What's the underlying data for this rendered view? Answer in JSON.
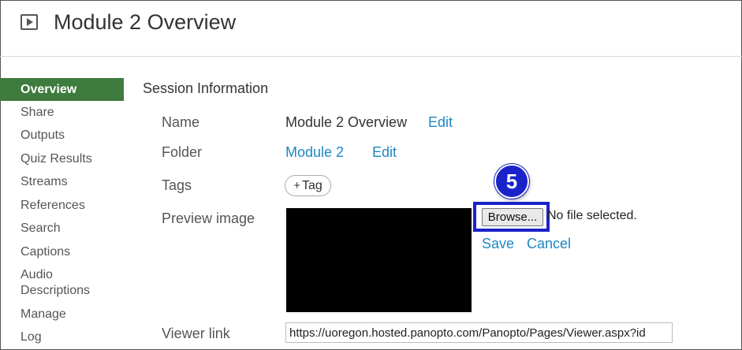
{
  "header": {
    "title": "Module 2 Overview"
  },
  "sidebar": {
    "items": [
      {
        "label": "Overview",
        "active": true
      },
      {
        "label": "Share"
      },
      {
        "label": "Outputs"
      },
      {
        "label": "Quiz Results"
      },
      {
        "label": "Streams"
      },
      {
        "label": "References"
      },
      {
        "label": "Search"
      },
      {
        "label": "Captions"
      },
      {
        "label": "Audio Descriptions"
      },
      {
        "label": "Manage"
      },
      {
        "label": "Log"
      }
    ]
  },
  "session": {
    "section_title": "Session Information",
    "name_label": "Name",
    "name_value": "Module 2 Overview",
    "folder_label": "Folder",
    "folder_value": "Module 2",
    "edit_label": "Edit",
    "tags_label": "Tags",
    "tag_button_label": "Tag",
    "preview_label": "Preview image",
    "browse_label": "Browse...",
    "no_file_text": "No file selected.",
    "save_label": "Save",
    "cancel_label": "Cancel",
    "viewer_label": "Viewer link",
    "viewer_url": "https://uoregon.hosted.panopto.com/Panopto/Pages/Viewer.aspx?id"
  },
  "annotation": {
    "step_number": "5",
    "color": "#1a22c9"
  },
  "colors": {
    "accent": "#3e7b3e",
    "link": "#1f86c4"
  },
  "icons": {
    "header": "play-icon"
  }
}
